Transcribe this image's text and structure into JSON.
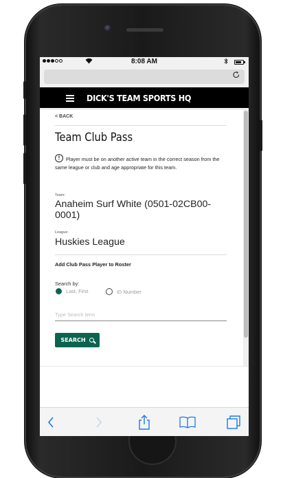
{
  "status_bar": {
    "time": "8:08 AM",
    "wifi_icon": "wifi-icon",
    "bluetooth_icon": "bluetooth-icon",
    "battery_icon": "battery-icon"
  },
  "browser": {
    "reload_icon": "reload-icon"
  },
  "site_header": {
    "brand": "DICK'S TEAM SPORTS HQ",
    "menu_icon": "hamburger-menu-icon"
  },
  "page": {
    "back_link": "< BACK",
    "title": "Team Club Pass",
    "info_icon": "info-circle-icon",
    "info_icon_glyph": "!",
    "notice": "Player must be on another active team in the correct season from the same league or club and age appropriate for this team.",
    "team_label": "Team:",
    "team_value": "Anaheim Surf White (0501-02CB00-0001)",
    "league_label": "League:",
    "league_value": "Huskies League",
    "add_section_title": "Add Club Pass Player to Roster",
    "search_by_label": "Search by:",
    "options": [
      {
        "label": "Last, First",
        "selected": true
      },
      {
        "label": "ID Number",
        "selected": false
      }
    ],
    "search_placeholder": "Type Search term",
    "search_value": "",
    "search_button": "SEARCH",
    "search_button_icon": "search-icon"
  },
  "browser_toolbar": {
    "items": [
      {
        "name": "back-icon",
        "enabled": true
      },
      {
        "name": "forward-icon",
        "enabled": false
      },
      {
        "name": "share-icon",
        "enabled": true
      },
      {
        "name": "bookmarks-icon",
        "enabled": true
      },
      {
        "name": "tabs-icon",
        "enabled": true
      }
    ]
  },
  "colors": {
    "accent": "#0c6450",
    "header_bg": "#000000",
    "ios_blue": "#1b7be6"
  }
}
